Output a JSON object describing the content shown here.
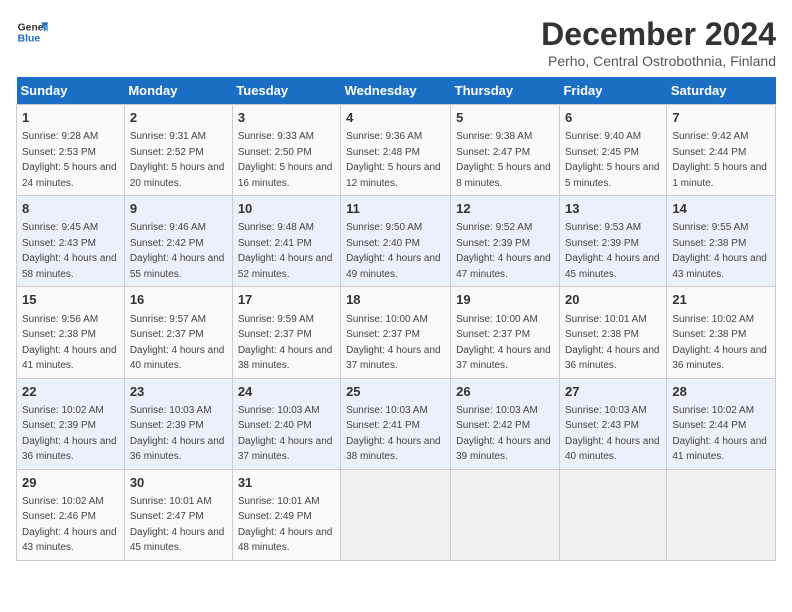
{
  "header": {
    "logo_general": "General",
    "logo_blue": "Blue",
    "month": "December 2024",
    "location": "Perho, Central Ostrobothnia, Finland"
  },
  "columns": [
    "Sunday",
    "Monday",
    "Tuesday",
    "Wednesday",
    "Thursday",
    "Friday",
    "Saturday"
  ],
  "weeks": [
    [
      {
        "day": "1",
        "sunrise": "9:28 AM",
        "sunset": "2:53 PM",
        "daylight": "5 hours and 24 minutes."
      },
      {
        "day": "2",
        "sunrise": "9:31 AM",
        "sunset": "2:52 PM",
        "daylight": "5 hours and 20 minutes."
      },
      {
        "day": "3",
        "sunrise": "9:33 AM",
        "sunset": "2:50 PM",
        "daylight": "5 hours and 16 minutes."
      },
      {
        "day": "4",
        "sunrise": "9:36 AM",
        "sunset": "2:48 PM",
        "daylight": "5 hours and 12 minutes."
      },
      {
        "day": "5",
        "sunrise": "9:38 AM",
        "sunset": "2:47 PM",
        "daylight": "5 hours and 8 minutes."
      },
      {
        "day": "6",
        "sunrise": "9:40 AM",
        "sunset": "2:45 PM",
        "daylight": "5 hours and 5 minutes."
      },
      {
        "day": "7",
        "sunrise": "9:42 AM",
        "sunset": "2:44 PM",
        "daylight": "5 hours and 1 minute."
      }
    ],
    [
      {
        "day": "8",
        "sunrise": "9:45 AM",
        "sunset": "2:43 PM",
        "daylight": "4 hours and 58 minutes."
      },
      {
        "day": "9",
        "sunrise": "9:46 AM",
        "sunset": "2:42 PM",
        "daylight": "4 hours and 55 minutes."
      },
      {
        "day": "10",
        "sunrise": "9:48 AM",
        "sunset": "2:41 PM",
        "daylight": "4 hours and 52 minutes."
      },
      {
        "day": "11",
        "sunrise": "9:50 AM",
        "sunset": "2:40 PM",
        "daylight": "4 hours and 49 minutes."
      },
      {
        "day": "12",
        "sunrise": "9:52 AM",
        "sunset": "2:39 PM",
        "daylight": "4 hours and 47 minutes."
      },
      {
        "day": "13",
        "sunrise": "9:53 AM",
        "sunset": "2:39 PM",
        "daylight": "4 hours and 45 minutes."
      },
      {
        "day": "14",
        "sunrise": "9:55 AM",
        "sunset": "2:38 PM",
        "daylight": "4 hours and 43 minutes."
      }
    ],
    [
      {
        "day": "15",
        "sunrise": "9:56 AM",
        "sunset": "2:38 PM",
        "daylight": "4 hours and 41 minutes."
      },
      {
        "day": "16",
        "sunrise": "9:57 AM",
        "sunset": "2:37 PM",
        "daylight": "4 hours and 40 minutes."
      },
      {
        "day": "17",
        "sunrise": "9:59 AM",
        "sunset": "2:37 PM",
        "daylight": "4 hours and 38 minutes."
      },
      {
        "day": "18",
        "sunrise": "10:00 AM",
        "sunset": "2:37 PM",
        "daylight": "4 hours and 37 minutes."
      },
      {
        "day": "19",
        "sunrise": "10:00 AM",
        "sunset": "2:37 PM",
        "daylight": "4 hours and 37 minutes."
      },
      {
        "day": "20",
        "sunrise": "10:01 AM",
        "sunset": "2:38 PM",
        "daylight": "4 hours and 36 minutes."
      },
      {
        "day": "21",
        "sunrise": "10:02 AM",
        "sunset": "2:38 PM",
        "daylight": "4 hours and 36 minutes."
      }
    ],
    [
      {
        "day": "22",
        "sunrise": "10:02 AM",
        "sunset": "2:39 PM",
        "daylight": "4 hours and 36 minutes."
      },
      {
        "day": "23",
        "sunrise": "10:03 AM",
        "sunset": "2:39 PM",
        "daylight": "4 hours and 36 minutes."
      },
      {
        "day": "24",
        "sunrise": "10:03 AM",
        "sunset": "2:40 PM",
        "daylight": "4 hours and 37 minutes."
      },
      {
        "day": "25",
        "sunrise": "10:03 AM",
        "sunset": "2:41 PM",
        "daylight": "4 hours and 38 minutes."
      },
      {
        "day": "26",
        "sunrise": "10:03 AM",
        "sunset": "2:42 PM",
        "daylight": "4 hours and 39 minutes."
      },
      {
        "day": "27",
        "sunrise": "10:03 AM",
        "sunset": "2:43 PM",
        "daylight": "4 hours and 40 minutes."
      },
      {
        "day": "28",
        "sunrise": "10:02 AM",
        "sunset": "2:44 PM",
        "daylight": "4 hours and 41 minutes."
      }
    ],
    [
      {
        "day": "29",
        "sunrise": "10:02 AM",
        "sunset": "2:46 PM",
        "daylight": "4 hours and 43 minutes."
      },
      {
        "day": "30",
        "sunrise": "10:01 AM",
        "sunset": "2:47 PM",
        "daylight": "4 hours and 45 minutes."
      },
      {
        "day": "31",
        "sunrise": "10:01 AM",
        "sunset": "2:49 PM",
        "daylight": "4 hours and 48 minutes."
      },
      null,
      null,
      null,
      null
    ]
  ]
}
